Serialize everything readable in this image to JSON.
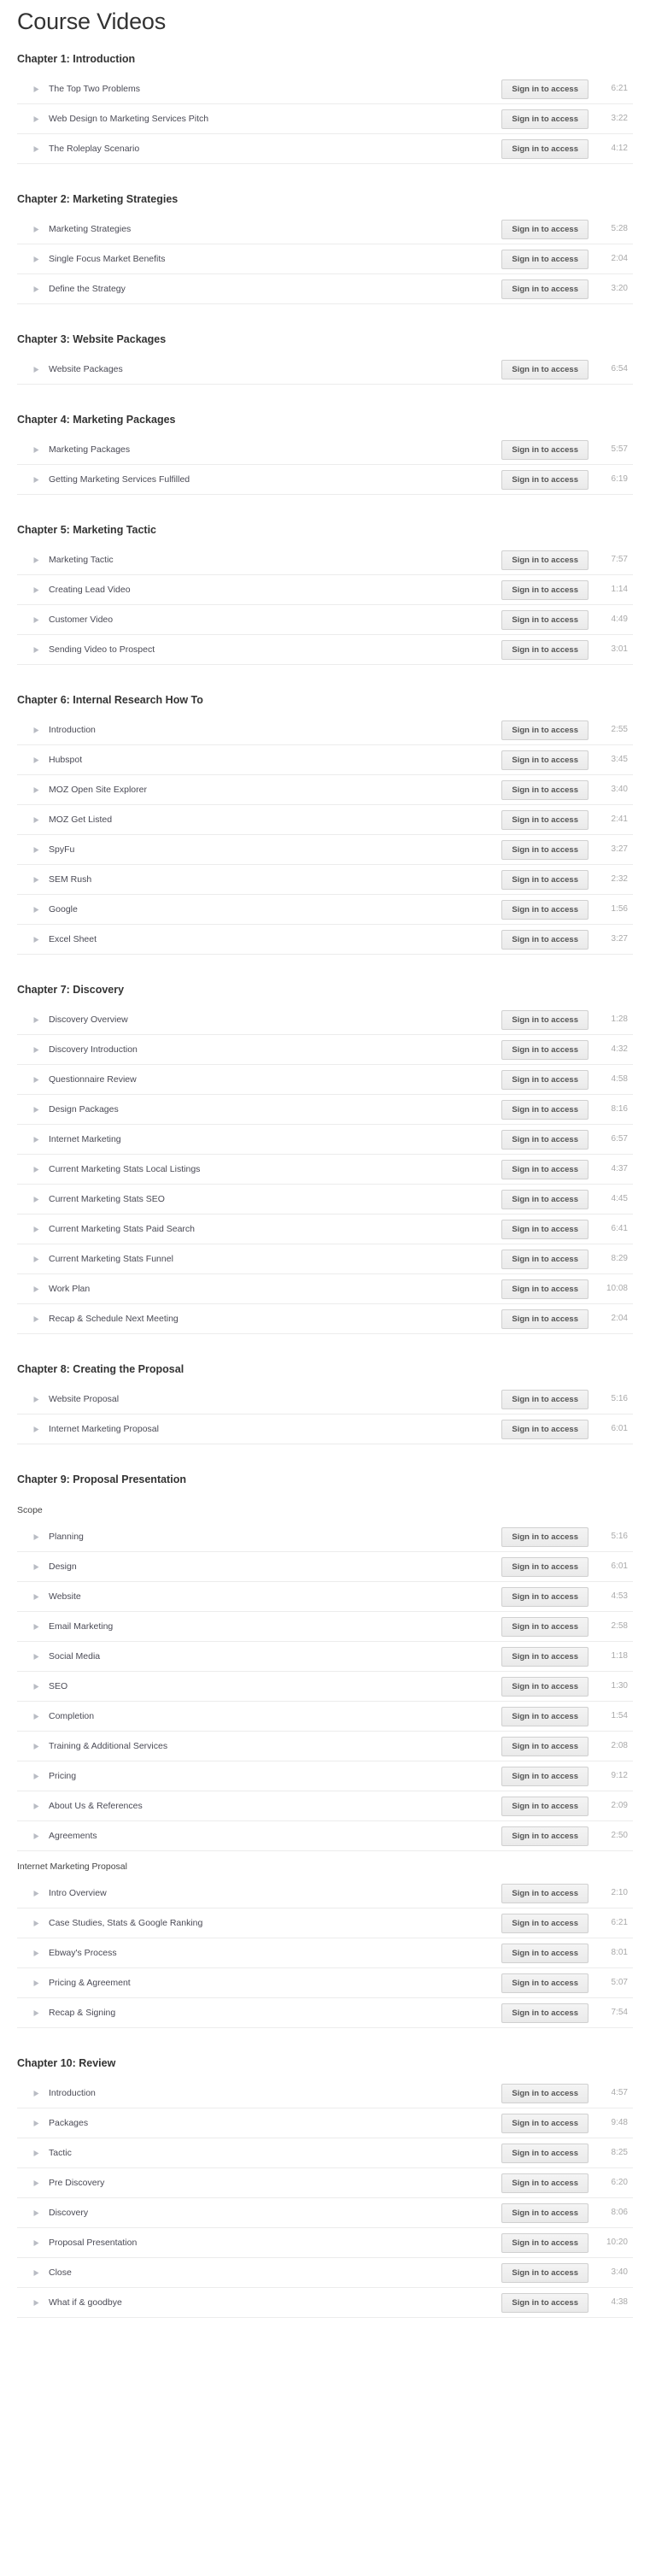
{
  "page": {
    "title": "Course Videos",
    "button_label": "Sign in to access",
    "play_icon": "play-triangle-icon"
  },
  "chapters": [
    {
      "title": "Chapter 1: Introduction",
      "groups": [
        {
          "label": null,
          "videos": [
            {
              "title": "The Top Two Problems",
              "duration": "6:21"
            },
            {
              "title": "Web Design to Marketing Services Pitch",
              "duration": "3:22"
            },
            {
              "title": "The Roleplay Scenario",
              "duration": "4:12"
            }
          ]
        }
      ]
    },
    {
      "title": "Chapter 2: Marketing Strategies",
      "groups": [
        {
          "label": null,
          "videos": [
            {
              "title": "Marketing Strategies",
              "duration": "5:28"
            },
            {
              "title": "Single Focus Market Benefits",
              "duration": "2:04"
            },
            {
              "title": "Define the Strategy",
              "duration": "3:20"
            }
          ]
        }
      ]
    },
    {
      "title": "Chapter 3: Website Packages",
      "groups": [
        {
          "label": null,
          "videos": [
            {
              "title": "Website Packages",
              "duration": "6:54"
            }
          ]
        }
      ]
    },
    {
      "title": "Chapter 4: Marketing Packages",
      "groups": [
        {
          "label": null,
          "videos": [
            {
              "title": "Marketing Packages",
              "duration": "5:57"
            },
            {
              "title": "Getting Marketing Services Fulfilled",
              "duration": "6:19"
            }
          ]
        }
      ]
    },
    {
      "title": "Chapter 5: Marketing Tactic",
      "groups": [
        {
          "label": null,
          "videos": [
            {
              "title": "Marketing Tactic",
              "duration": "7:57"
            },
            {
              "title": "Creating Lead Video",
              "duration": "1:14"
            },
            {
              "title": "Customer Video",
              "duration": "4:49"
            },
            {
              "title": "Sending Video to Prospect",
              "duration": "3:01"
            }
          ]
        }
      ]
    },
    {
      "title": "Chapter 6: Internal Research How To",
      "groups": [
        {
          "label": null,
          "videos": [
            {
              "title": "Introduction",
              "duration": "2:55"
            },
            {
              "title": "Hubspot",
              "duration": "3:45"
            },
            {
              "title": "MOZ Open Site Explorer",
              "duration": "3:40"
            },
            {
              "title": "MOZ Get Listed",
              "duration": "2:41"
            },
            {
              "title": "SpyFu",
              "duration": "3:27"
            },
            {
              "title": "SEM Rush",
              "duration": "2:32"
            },
            {
              "title": "Google",
              "duration": "1:56"
            },
            {
              "title": "Excel Sheet",
              "duration": "3:27"
            }
          ]
        }
      ]
    },
    {
      "title": "Chapter 7: Discovery",
      "groups": [
        {
          "label": null,
          "videos": [
            {
              "title": "Discovery Overview",
              "duration": "1:28"
            },
            {
              "title": "Discovery Introduction",
              "duration": "4:32"
            },
            {
              "title": "Questionnaire Review",
              "duration": "4:58"
            },
            {
              "title": "Design Packages",
              "duration": "8:16"
            },
            {
              "title": "Internet Marketing",
              "duration": "6:57"
            },
            {
              "title": "Current Marketing Stats Local Listings",
              "duration": "4:37"
            },
            {
              "title": "Current Marketing Stats SEO",
              "duration": "4:45"
            },
            {
              "title": "Current Marketing Stats Paid Search",
              "duration": "6:41"
            },
            {
              "title": "Current Marketing Stats Funnel",
              "duration": "8:29"
            },
            {
              "title": "Work Plan",
              "duration": "10:08"
            },
            {
              "title": "Recap & Schedule Next Meeting",
              "duration": "2:04"
            }
          ]
        }
      ]
    },
    {
      "title": "Chapter 8: Creating the Proposal",
      "groups": [
        {
          "label": null,
          "videos": [
            {
              "title": "Website Proposal",
              "duration": "5:16"
            },
            {
              "title": "Internet Marketing Proposal",
              "duration": "6:01"
            }
          ]
        }
      ]
    },
    {
      "title": "Chapter 9: Proposal Presentation",
      "groups": [
        {
          "label": "Scope",
          "videos": [
            {
              "title": "Planning",
              "duration": "5:16"
            },
            {
              "title": "Design",
              "duration": "6:01"
            },
            {
              "title": "Website",
              "duration": "4:53"
            },
            {
              "title": "Email Marketing",
              "duration": "2:58"
            },
            {
              "title": "Social Media",
              "duration": "1:18"
            },
            {
              "title": "SEO",
              "duration": "1:30"
            },
            {
              "title": "Completion",
              "duration": "1:54"
            },
            {
              "title": "Training & Additional Services",
              "duration": "2:08"
            },
            {
              "title": "Pricing",
              "duration": "9:12"
            },
            {
              "title": "About Us & References",
              "duration": "2:09"
            },
            {
              "title": "Agreements",
              "duration": "2:50"
            }
          ]
        },
        {
          "label": "Internet Marketing Proposal",
          "videos": [
            {
              "title": "Intro Overview",
              "duration": "2:10"
            },
            {
              "title": "Case Studies, Stats & Google Ranking",
              "duration": "6:21"
            },
            {
              "title": "Ebway's Process",
              "duration": "8:01"
            },
            {
              "title": "Pricing & Agreement",
              "duration": "5:07"
            },
            {
              "title": "Recap & Signing",
              "duration": "7:54"
            }
          ]
        }
      ]
    },
    {
      "title": "Chapter 10: Review",
      "groups": [
        {
          "label": null,
          "videos": [
            {
              "title": "Introduction",
              "duration": "4:57"
            },
            {
              "title": "Packages",
              "duration": "9:48"
            },
            {
              "title": "Tactic",
              "duration": "8:25"
            },
            {
              "title": "Pre Discovery",
              "duration": "6:20"
            },
            {
              "title": "Discovery",
              "duration": "8:06"
            },
            {
              "title": "Proposal Presentation",
              "duration": "10:20"
            },
            {
              "title": "Close",
              "duration": "3:40"
            },
            {
              "title": "What if & goodbye",
              "duration": "4:38"
            }
          ]
        }
      ]
    }
  ]
}
